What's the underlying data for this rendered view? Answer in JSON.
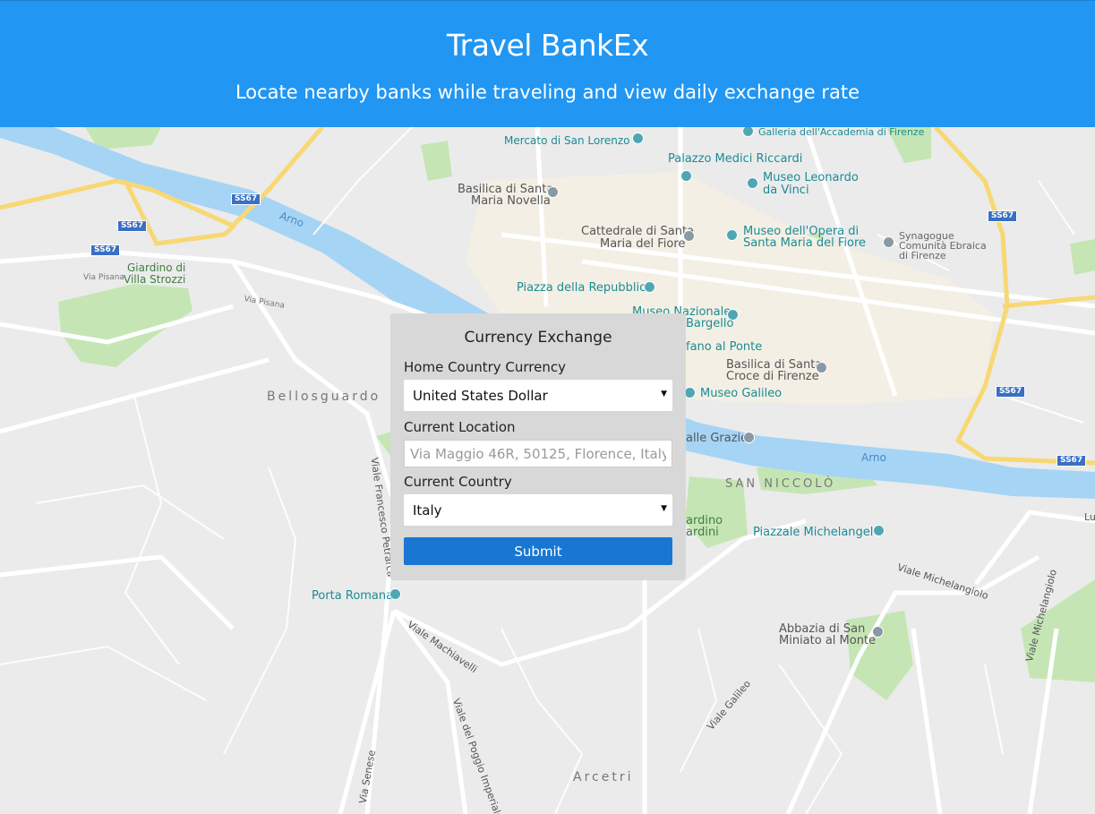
{
  "header": {
    "title": "Travel BankEx",
    "subtitle": "Locate nearby banks while traveling and view daily exchange rate"
  },
  "form": {
    "title": "Currency Exchange",
    "home_currency_label": "Home Country Currency",
    "home_currency_value": "United States Dollar",
    "location_label": "Current Location",
    "location_placeholder": "Via Maggio 46R, 50125, Florence, Italy",
    "country_label": "Current Country",
    "country_value": "Italy",
    "submit_label": "Submit"
  },
  "map": {
    "labels": {
      "mercato": "Mercato di San Lorenzo",
      "galleria": "Galleria dell'Accademia di Firenze",
      "medici": "Palazzo Medici Riccardi",
      "leonardo1": "Museo Leonardo",
      "leonardo2": "da Vinci",
      "santa_maria1": "Basilica di Santa",
      "santa_maria2": "Maria Novella",
      "cattedrale1": "Cattedrale di Santa",
      "cattedrale2": "Maria del Fiore",
      "opera1": "Museo dell'Opera di",
      "opera2": "Santa Maria del Fiore",
      "synagogue1": "Synagogue",
      "synagogue2": "Comunità Ebraica",
      "synagogue3": "di Firenze",
      "giardino1": "Giardino di",
      "giardino2": "Villa Strozzi",
      "repubblica": "Piazza della Repubblica",
      "bargello1": "Museo Nazionale",
      "bargello2": "Bargello",
      "ponte": "fano al Ponte",
      "santa_croce1": "Basilica di Santa",
      "santa_croce2": "Croce di Firenze",
      "galileo": "Museo Galileo",
      "grazie": "alle Grazie",
      "bellosguardo": "Bellosguardo",
      "san_niccolo": "SAN NICCOLÒ",
      "bardini1": "ardino",
      "bardini2": "ardini",
      "michelangelo": "Piazzale Michelangelo",
      "porta_romana": "Porta Romana",
      "abbazia1": "Abbazia di San",
      "abbazia2": "Miniato al Monte",
      "arcetri": "Arcetri",
      "arno1": "Arno",
      "arno2": "Arno",
      "ss67_1": "SS67",
      "ss67_2": "SS67",
      "ss67_3": "SS67",
      "ss67_4": "SS67",
      "ss67_5": "SS67",
      "ss67_6": "SS67",
      "viale_michelangiolo": "Viale Michelangiolo",
      "viale_michelangiolo2": "Viale Michelangiolo",
      "viale_galileo": "Viale Galileo",
      "viale_machiavelli": "Viale Machiavelli",
      "via_senese": "Via Senese",
      "viale_petrarca": "Viale Francesco Petrarca",
      "via_pisana": "Via Pisana",
      "via_pisana2": "Via Pisana",
      "via_poggio": "Viale del Poggio Imperiale",
      "lu": "Lu"
    }
  }
}
